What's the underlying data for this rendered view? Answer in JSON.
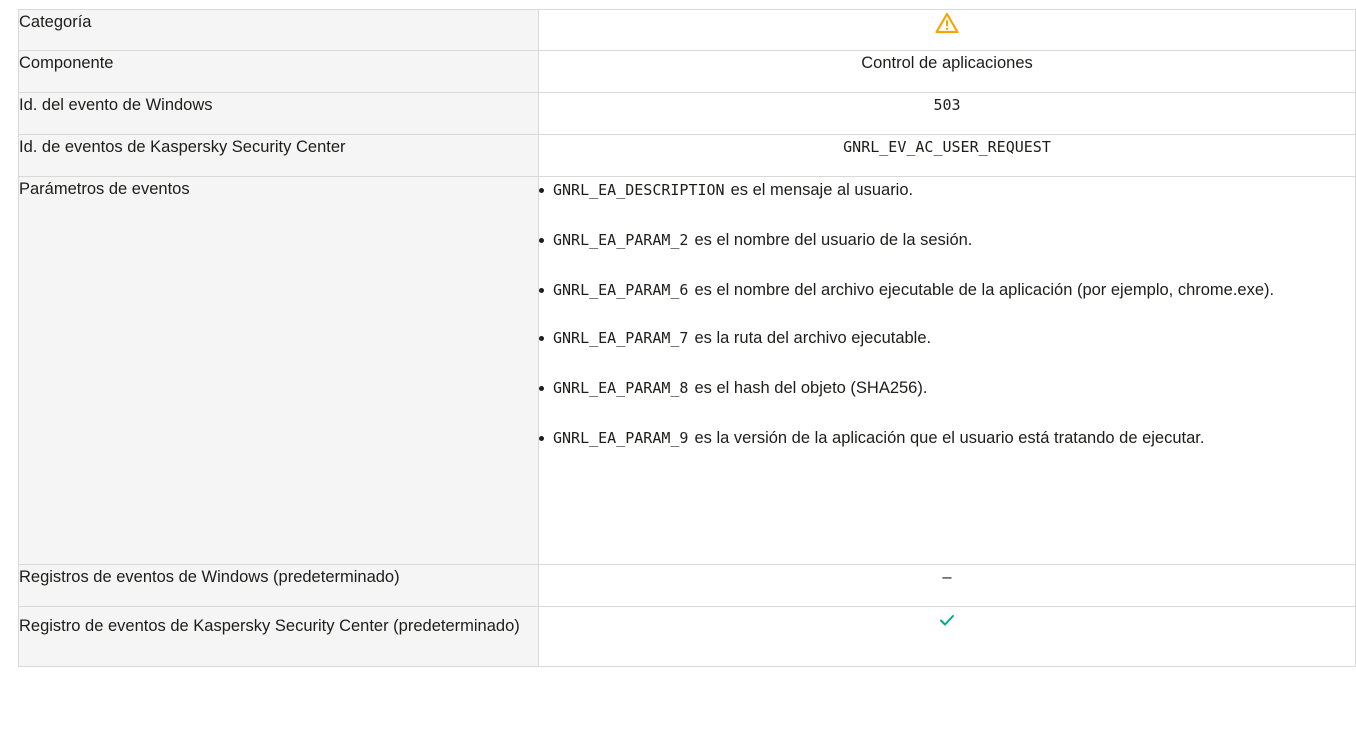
{
  "rows": {
    "category": {
      "label": "Categoría",
      "icon": "warning-icon",
      "icon_color": "#f6a600"
    },
    "component": {
      "label": "Componente",
      "value": "Control de aplicaciones"
    },
    "windows_event_id": {
      "label": "Id. del evento de Windows",
      "value": "503"
    },
    "ksc_event_id": {
      "label": "Id. de eventos de Kaspersky Security Center",
      "value": "GNRL_EV_AC_USER_REQUEST"
    },
    "event_params": {
      "label": "Parámetros de eventos",
      "items": [
        {
          "code": "GNRL_EA_DESCRIPTION",
          "text": "es el mensaje al usuario."
        },
        {
          "code": "GNRL_EA_PARAM_2",
          "text": "es el nombre del usuario de la sesión."
        },
        {
          "code": "GNRL_EA_PARAM_6",
          "text": "es el nombre del archivo ejecutable de la aplicación (por ejemplo, chrome.exe)."
        },
        {
          "code": "GNRL_EA_PARAM_7",
          "text": "es la ruta del archivo ejecutable."
        },
        {
          "code": "GNRL_EA_PARAM_8",
          "text": "es el hash del objeto (SHA256)."
        },
        {
          "code": "GNRL_EA_PARAM_9",
          "text": "es la versión de la aplicación que el usuario está tratando de ejecutar."
        }
      ]
    },
    "windows_logs": {
      "label": "Registros de eventos de Windows (predeterminado)",
      "value": "–"
    },
    "ksc_log": {
      "label": "Registro de eventos de Kaspersky Security Center (predeterminado)",
      "icon": "check-icon",
      "icon_color": "#00a88e"
    }
  }
}
